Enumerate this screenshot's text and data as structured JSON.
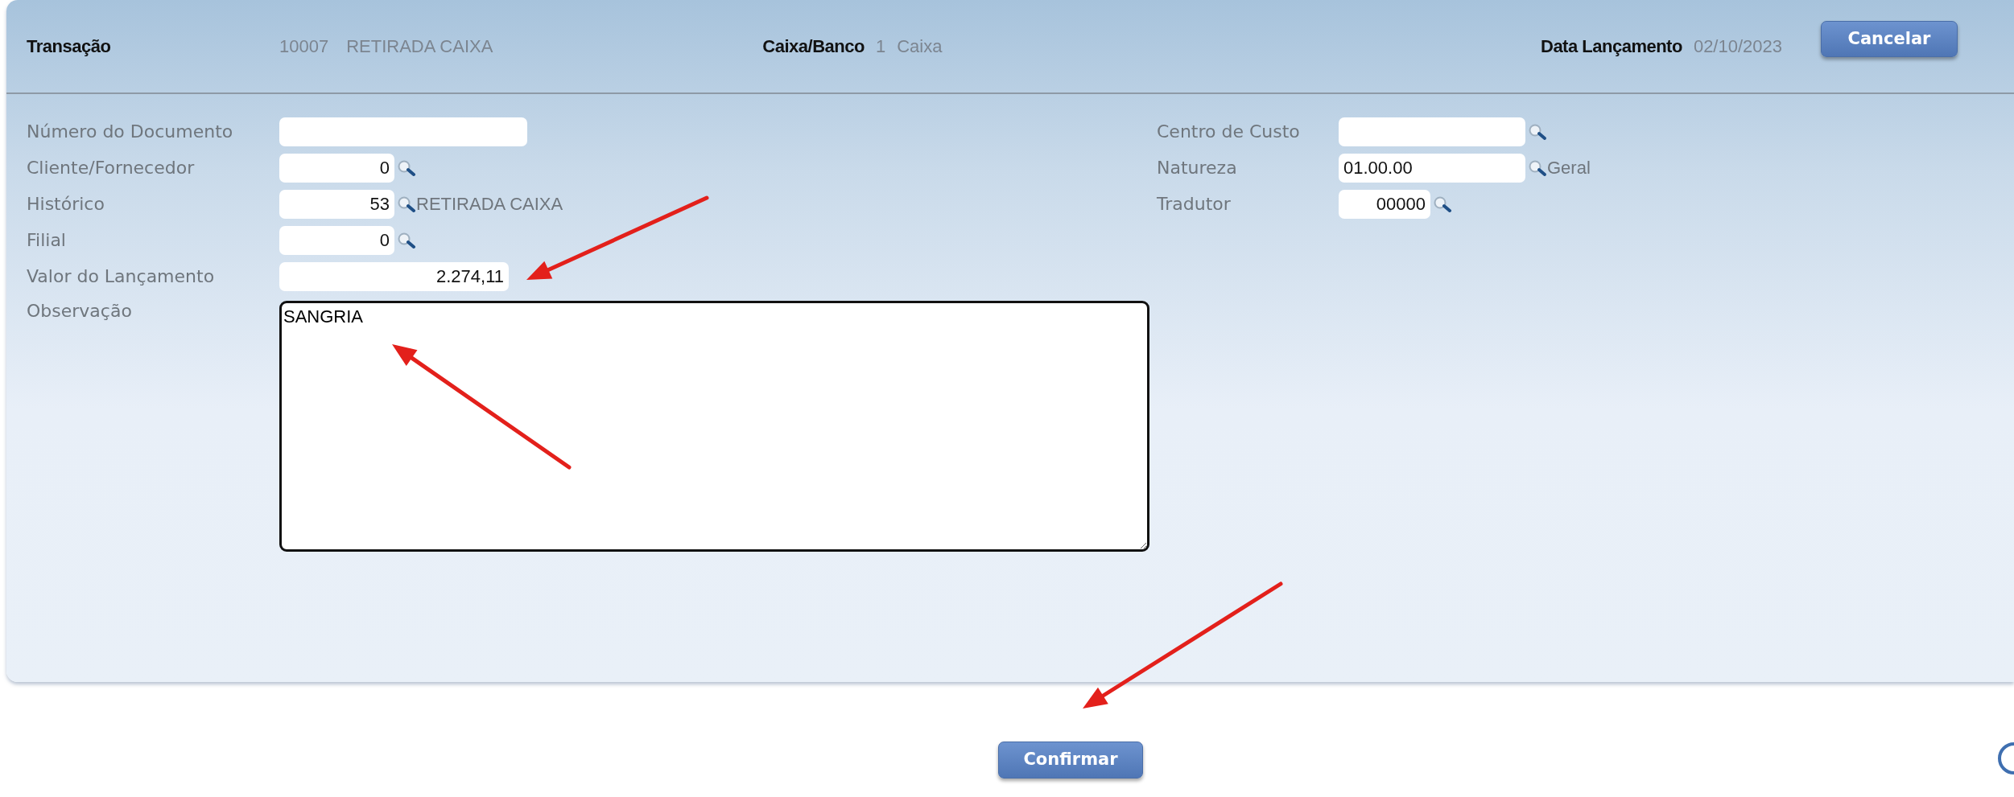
{
  "header": [
    {
      "label": "Transação",
      "values": [
        "10007",
        "RETIRADA CAIXA"
      ]
    },
    {
      "label": "Caixa/Banco",
      "values": [
        "1",
        "Caixa"
      ]
    },
    {
      "label": "Data Lançamento",
      "values": [
        "02/10/2023"
      ]
    }
  ],
  "cancel_button": "Cancelar",
  "left_fields": [
    {
      "label": "Número do Documento",
      "kind": "text"
    },
    {
      "label": "Cliente/Fornecedor",
      "kind": "code",
      "value": "0"
    },
    {
      "label": "Histórico",
      "kind": "code",
      "value": "53",
      "description": "RETIRADA CAIXA"
    },
    {
      "label": "Filial",
      "kind": "code",
      "value": "0"
    },
    {
      "label": "Valor do Lançamento",
      "kind": "amount",
      "value": "2.274,11"
    }
  ],
  "observation": {
    "label": "Observação",
    "value": "SANGRIA"
  },
  "right_fields": [
    {
      "label": "Centro de Custo",
      "kind": "account"
    },
    {
      "label": "Natureza",
      "kind": "account",
      "value": "01.00.00",
      "description": "Geral"
    },
    {
      "label": "Tradutor",
      "kind": "short",
      "value": "00000"
    }
  ],
  "confirm_button": "Confirmar"
}
